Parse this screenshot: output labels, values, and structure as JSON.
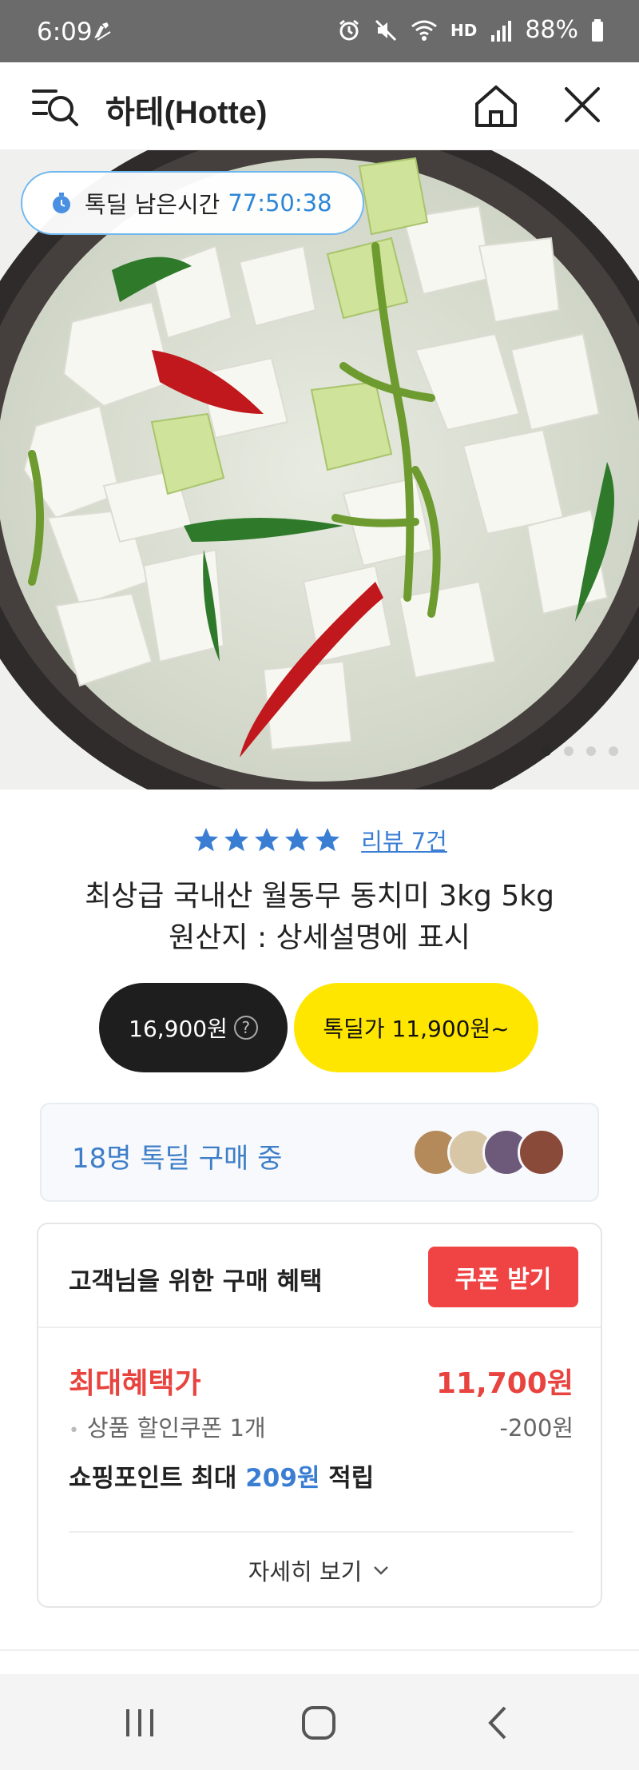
{
  "status_bar": {
    "time": "6:09",
    "battery": "88%",
    "network": "HD"
  },
  "app_bar": {
    "title": "하테(Hotte)"
  },
  "hero": {
    "timer_label": "톡딜 남은시간",
    "timer_value": "77:50:38",
    "image_subject": "동치미 (radish water kimchi with chili peppers)",
    "carousel_dots": 4,
    "carousel_active_index": 0
  },
  "product": {
    "rating": 5,
    "review_link": "리뷰 7건",
    "title_line1": "최상급 국내산 월동무 동치미 3kg 5kg",
    "title_line2": "원산지 : 상세설명에 표시",
    "regular_price": "16,900원",
    "regular_price_help": "?",
    "deal_price": "톡딜가 11,900원~"
  },
  "buyers": {
    "text": "18명 톡딜 구매 중"
  },
  "benefits": {
    "header": "고객님을 위한 구매 혜택",
    "coupon_button": "쿠폰 받기",
    "max_label": "최대혜택가",
    "max_value": "11,700원",
    "coupon_label": "상품 할인쿠폰 1개",
    "coupon_value": "-200원",
    "points_prefix": "쇼핑포인트 최대",
    "points_value": "209원",
    "points_suffix": "적립",
    "more_label": "자세히 보기"
  },
  "colors": {
    "accent_blue": "#3a7ed4",
    "deal_yellow": "#ffe600",
    "coupon_red": "#f04444",
    "price_red": "#e8433f"
  }
}
